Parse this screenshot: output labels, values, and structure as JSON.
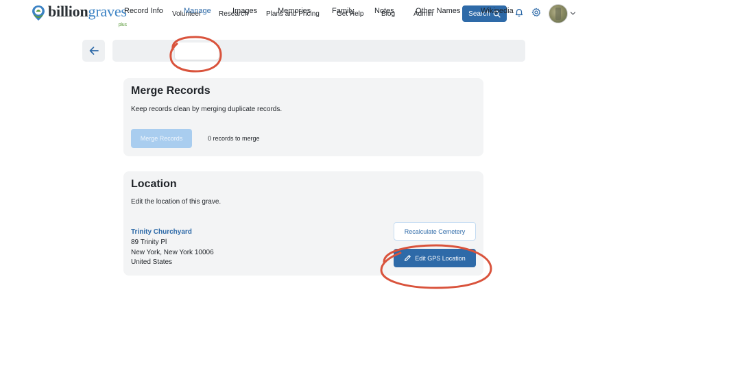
{
  "header": {
    "logo": {
      "brand_bold": "billion",
      "brand_light": "graves",
      "tier": "plus"
    },
    "nav": [
      "Volunteer",
      "Research",
      "Plans and Pricing",
      "Get Help",
      "Blog",
      "Admin"
    ],
    "search_label": "Search",
    "icons": {
      "search": "magnifier-icon",
      "notifications": "bell-icon",
      "settings": "gear-icon",
      "account": "chevron-down-icon"
    }
  },
  "tabs": {
    "items": [
      "Record Info",
      "Manage",
      "Images",
      "Memories",
      "Family",
      "Notes",
      "Other Names",
      "Wikipedia"
    ],
    "active": "Manage"
  },
  "merge": {
    "title": "Merge Records",
    "description": "Keep records clean by merging duplicate records.",
    "button_label": "Merge Records",
    "count_text": "0 records to merge"
  },
  "location": {
    "title": "Location",
    "description": "Edit the location of this grave.",
    "cemetery_name": "Trinity Churchyard",
    "address_lines": [
      "89 Trinity Pl",
      "New York, New York 10006",
      "United States"
    ],
    "recalculate_label": "Recalculate Cemetery",
    "edit_gps_label": "Edit GPS Location"
  },
  "colors": {
    "primary": "#2e6aa8",
    "disabled_button": "#a9cdef",
    "card_background": "#f3f4f5",
    "annotation": "#d9533c"
  }
}
